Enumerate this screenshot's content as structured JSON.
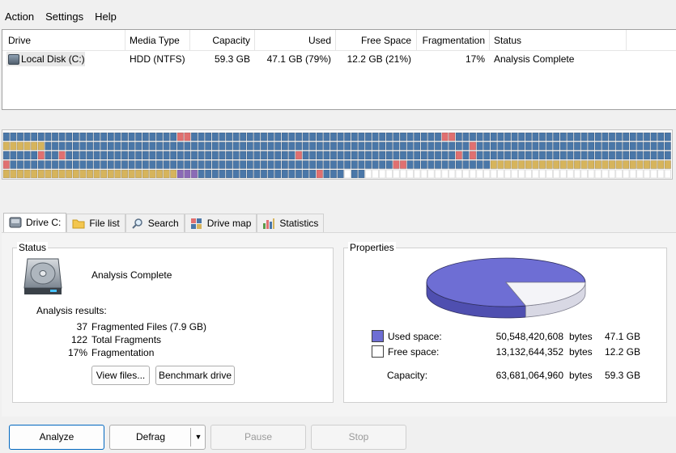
{
  "menu": [
    "Action",
    "Settings",
    "Help"
  ],
  "drive_list": {
    "columns": [
      "Drive",
      "Media Type",
      "Capacity",
      "Used",
      "Free Space",
      "Fragmentation",
      "Status"
    ],
    "rows": [
      {
        "drive": "Local Disk  (C:)",
        "media": "HDD (NTFS)",
        "capacity": "59.3 GB",
        "used": "47.1 GB (79%)",
        "free": "12.2 GB (21%)",
        "fragmentation": "17%",
        "status": "Analysis Complete"
      }
    ]
  },
  "cluster_map": {
    "colors": {
      "used": "#4a77a8",
      "fragmented": "#e07070",
      "system": "#d6b45c",
      "mft": "#8a6ab6",
      "free": "#ffffff"
    },
    "rows": [
      "UUUUUUUUUUUUUUUUUUUUUUUUUFFUUUUUUUUUUUUUUUUUUUUUUUUUUUUUUUUUUUUFFUUUUUUUUUUUUUUUUUUUUUUUUUUUUUUUUUUSSSS",
      "SSSSSSUUUUUUUUUUUUUUUUUUUUUUUUUUUUUUUUUUUUUUUUUUUUUUUUUUUUUUUUUUUUUFUUUUUUUUUUUUUUUUUUUUUUUUUUUUUUUUUUUUUU",
      "UUUUUFUUFUUUUUUUUUUUUUUUUUUUUUUUUUUUUUUUUUFUUUUUUUUUUUUUUUUUUUUUUFUFUUUUUUUUUUUUUUUUUUUUUUUUUUUUUUUUUFUUU",
      "FUUUUUUUUUUUUUUUUUUUUUUUUUUUUUUUUUUUUUUUUUUUUUUUUUUUUUUUFFUUUUUUUUUUUUSSSSSSSSSSSSSSSSSSSSSSSSSSSSSSSSSSSS",
      "SSSSSSSSSSSSSSSSSSSSSSSSSMMMUUUUUUUUUUUUUUUUUFUUU.UU..........................................................."
    ]
  },
  "tabs": [
    {
      "label": "Drive C:",
      "icon": "disk-icon"
    },
    {
      "label": "File list",
      "icon": "folder-icon"
    },
    {
      "label": "Search",
      "icon": "magnifier-icon"
    },
    {
      "label": "Drive map",
      "icon": "blocks-icon"
    },
    {
      "label": "Statistics",
      "icon": "bar-chart-icon"
    }
  ],
  "status_group": {
    "title": "Status",
    "status": "Analysis Complete",
    "results_label": "Analysis results:",
    "results": [
      {
        "value": "37",
        "label": "Fragmented Files (7.9 GB)"
      },
      {
        "value": "122",
        "label": "Total Fragments"
      },
      {
        "value": "17%",
        "label": "Fragmentation"
      }
    ],
    "view_files_button": "View files...",
    "benchmark_button": "Benchmark drive"
  },
  "properties_group": {
    "title": "Properties",
    "used_label": "Used space:",
    "used_bytes": "50,548,420,608",
    "used_gb": "47.1 GB",
    "free_label": "Free space:",
    "free_bytes": "13,132,644,352",
    "free_gb": "12.2 GB",
    "capacity_label": "Capacity:",
    "capacity_bytes": "63,681,064,960",
    "capacity_gb": "59.3 GB",
    "bytes_unit": "bytes",
    "used_fraction": 0.79,
    "used_color": "#6e6ed4",
    "free_color": "#f4f4f8"
  },
  "actions": {
    "analyze": "Analyze",
    "defrag": "Defrag",
    "pause": "Pause",
    "stop": "Stop"
  }
}
